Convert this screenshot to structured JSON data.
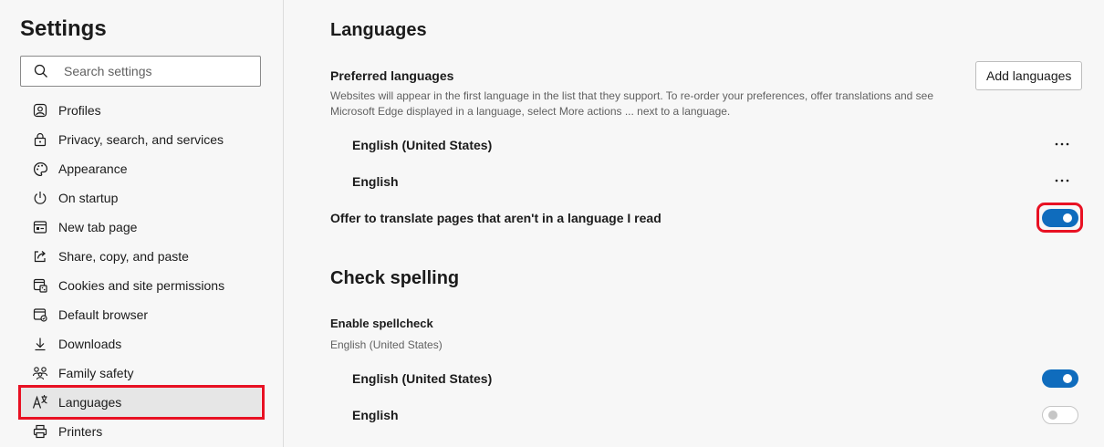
{
  "sidebar": {
    "title": "Settings",
    "search_placeholder": "Search settings",
    "items": [
      {
        "label": "Profiles",
        "icon": "profile-icon"
      },
      {
        "label": "Privacy, search, and services",
        "icon": "lock-icon"
      },
      {
        "label": "Appearance",
        "icon": "palette-icon"
      },
      {
        "label": "On startup",
        "icon": "power-icon"
      },
      {
        "label": "New tab page",
        "icon": "new-tab-icon"
      },
      {
        "label": "Share, copy, and paste",
        "icon": "share-icon"
      },
      {
        "label": "Cookies and site permissions",
        "icon": "cookies-icon"
      },
      {
        "label": "Default browser",
        "icon": "browser-icon"
      },
      {
        "label": "Downloads",
        "icon": "download-icon"
      },
      {
        "label": "Family safety",
        "icon": "family-icon"
      },
      {
        "label": "Languages",
        "icon": "languages-icon",
        "active": true
      },
      {
        "label": "Printers",
        "icon": "printer-icon"
      }
    ]
  },
  "languages": {
    "title": "Languages",
    "preferred_label": "Preferred languages",
    "preferred_desc_line1": "Websites will appear in the first language in the list that they support. To re-order your preferences, offer translations and see",
    "preferred_desc_line2": "Microsoft Edge displayed in a language, select More actions ... next to a language.",
    "add_button": "Add languages",
    "list": [
      {
        "label": "English (United States)",
        "more": "⋯"
      },
      {
        "label": "English",
        "more": "⋯"
      }
    ],
    "translate_label": "Offer to translate pages that aren't in a language I read",
    "translate_on": true
  },
  "spelling": {
    "title": "Check spelling",
    "enable_label": "Enable spellcheck",
    "enable_sub": "English (United States)",
    "items": [
      {
        "label": "English (United States)",
        "on": true
      },
      {
        "label": "English",
        "on": false
      }
    ]
  },
  "colors": {
    "accent": "#0f6cbd",
    "highlight": "#e81123"
  }
}
